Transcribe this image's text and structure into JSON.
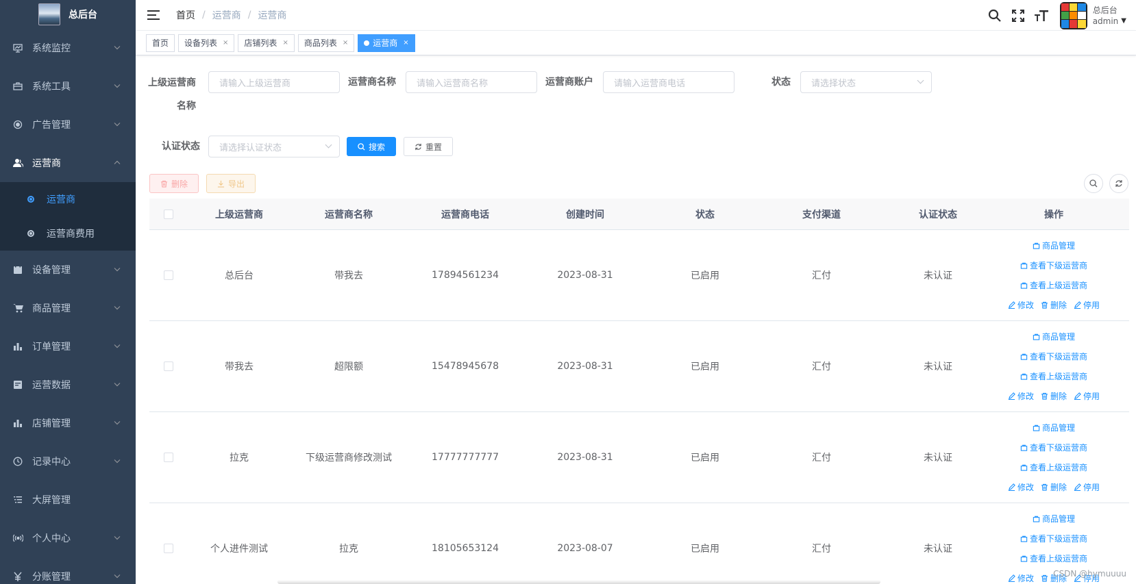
{
  "sidebar": {
    "title": "总后台",
    "items": [
      {
        "label": "系统监控",
        "icon": "monitor-icon"
      },
      {
        "label": "系统工具",
        "icon": "toolbox-icon"
      },
      {
        "label": "广告管理",
        "icon": "target-icon"
      },
      {
        "label": "运营商",
        "icon": "user-icon"
      },
      {
        "label": "设备管理",
        "icon": "calendar-icon"
      },
      {
        "label": "商品管理",
        "icon": "cart-icon"
      },
      {
        "label": "订单管理",
        "icon": "bar-chart-icon"
      },
      {
        "label": "运营数据",
        "icon": "data-icon"
      },
      {
        "label": "店铺管理",
        "icon": "bar-chart-icon"
      },
      {
        "label": "记录中心",
        "icon": "clock-icon"
      },
      {
        "label": "大屏管理",
        "icon": "list-icon"
      },
      {
        "label": "个人中心",
        "icon": "signal-icon"
      },
      {
        "label": "分账管理",
        "icon": "yen-icon"
      }
    ],
    "sub_items": [
      {
        "label": "运营商"
      },
      {
        "label": "运营商费用"
      }
    ]
  },
  "navbar": {
    "breadcrumb": [
      "首页",
      "运营商",
      "运营商"
    ],
    "user_name": "总后台",
    "user_role": "admin"
  },
  "tags": [
    {
      "label": "首页"
    },
    {
      "label": "设备列表"
    },
    {
      "label": "店铺列表"
    },
    {
      "label": "商品列表"
    },
    {
      "label": "运营商"
    }
  ],
  "search": {
    "parent_label_1": "上级运营商",
    "parent_label_2": "名称",
    "parent_placeholder": "请输入上级运营商",
    "name_label": "运营商名称",
    "name_placeholder": "请输入运营商名称",
    "account_label": "运营商账户",
    "account_placeholder": "请输入运营商电话",
    "status_label": "状态",
    "status_placeholder": "请选择状态",
    "auth_label": "认证状态",
    "auth_placeholder": "请选择认证状态",
    "search_button": "搜索",
    "reset_button": "重置"
  },
  "toolbar": {
    "delete_button": "删除",
    "export_button": "导出"
  },
  "table": {
    "columns": [
      "上级运营商",
      "运营商名称",
      "运营商电话",
      "创建时间",
      "状态",
      "支付渠道",
      "认证状态",
      "操作"
    ],
    "rows": [
      {
        "parent": "总后台",
        "name": "带我去",
        "phone": "17894561234",
        "created": "2023-08-31",
        "status": "已启用",
        "channel": "汇付",
        "auth": "未认证"
      },
      {
        "parent": "带我去",
        "name": "超限额",
        "phone": "15478945678",
        "created": "2023-08-31",
        "status": "已启用",
        "channel": "汇付",
        "auth": "未认证"
      },
      {
        "parent": "拉克",
        "name": "下级运营商修改测试",
        "phone": "17777777777",
        "created": "2023-08-31",
        "status": "已启用",
        "channel": "汇付",
        "auth": "未认证"
      },
      {
        "parent": "个人进件测试",
        "name": "拉克",
        "phone": "18105653124",
        "created": "2023-08-07",
        "status": "已启用",
        "channel": "汇付",
        "auth": "未认证"
      }
    ],
    "ops": {
      "goods": "商品管理",
      "view_sub": "查看下级运营商",
      "view_parent": "查看上级运营商",
      "edit": "修改",
      "delete": "删除",
      "disable": "停用"
    }
  },
  "watermark": "CSDN @hymuuuu",
  "colors": {
    "sidebar_bg": "#304156",
    "submenu_bg": "#1f2d3d",
    "primary": "#1890ff",
    "active_tag": "#409eff"
  }
}
